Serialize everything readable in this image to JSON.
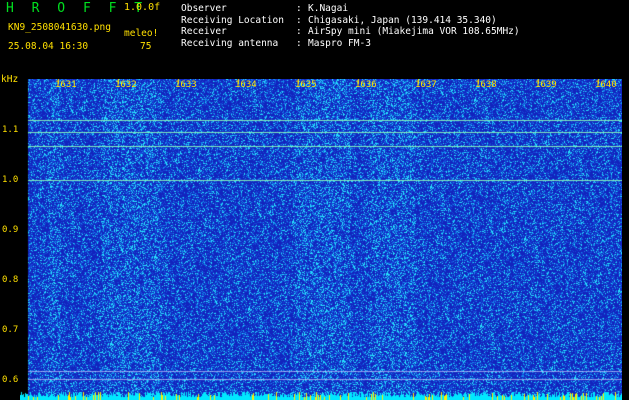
{
  "header": {
    "title": "H R O F F T",
    "version": "1.0.0f",
    "filename": "KN9_2508041630.png",
    "datetime": "25.08.04 16:30",
    "meleo_label": "meleo!",
    "meleo_value": "75"
  },
  "meta": [
    {
      "key": "Observer",
      "sep": ":",
      "value": "K.Nagai"
    },
    {
      "key": "Receiving Location",
      "sep": ":",
      "value": "Chigasaki, Japan (139.414 35.340)"
    },
    {
      "key": "Receiver",
      "sep": ":",
      "value": "AirSpy mini (Miakejima VOR 108.65MHz)"
    },
    {
      "key": "Receiving antenna",
      "sep": ":",
      "value": "Maspro FM-3"
    }
  ],
  "axis": {
    "y_unit": "kHz",
    "y_ticks": [
      "1.1",
      "1.0",
      "0.9",
      "0.8",
      "0.7",
      "0.6"
    ],
    "x_ticks": [
      "1631",
      "1632",
      "1633",
      "1634",
      "1635",
      "1636",
      "1637",
      "1638",
      "1639",
      "1640"
    ]
  },
  "colors": {
    "background": "#000000",
    "label": "#ffe000",
    "title": "#00e020",
    "waterfall_base": "#1428c8",
    "noise_floor": "#00e8ff"
  }
}
